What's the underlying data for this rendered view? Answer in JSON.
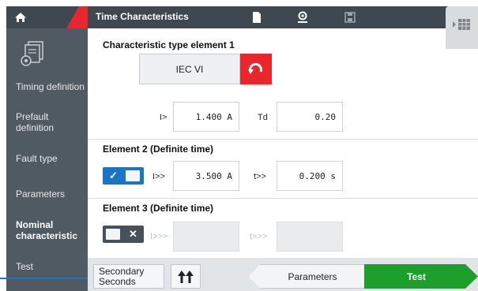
{
  "header": {
    "title": "Time Characteristics"
  },
  "sidebar": {
    "items": [
      {
        "label": "Timing definition",
        "active": false
      },
      {
        "label": "Prefault definition",
        "active": false
      },
      {
        "label": "Fault type",
        "active": false
      },
      {
        "label": "Parameters",
        "active": false
      },
      {
        "label": "Nominal characteristic",
        "active": true
      },
      {
        "label": "Test",
        "active": false
      }
    ]
  },
  "icons": {
    "home": "home-icon",
    "definition": "document-settings-icon",
    "header": [
      "document-icon",
      "person-location-icon",
      "save-icon"
    ],
    "panel": "grid-panel-icon",
    "reset": "undo-arrow-icon",
    "swap": "double-up-arrow-icon"
  },
  "main": {
    "element1": {
      "title": "Characteristic type element 1",
      "characteristic_value": "IEC VI",
      "i_label": "I>",
      "i_value": "1.400 A",
      "td_label": "Td",
      "td_value": "0.20"
    },
    "element2": {
      "title": "Element 2 (Definite time)",
      "enabled": true,
      "i_label": "I>>",
      "i_value": "3.500 A",
      "t_label": "t>>",
      "t_value": "0.200 s"
    },
    "element3": {
      "title": "Element 3 (Definite time)",
      "enabled": false,
      "i_label": "I>>>",
      "i_value": "",
      "t_label": "t>>>",
      "t_value": ""
    }
  },
  "bottombar": {
    "secondary_label": "Secondary Seconds",
    "prev_label": "Parameters",
    "next_label": "Test"
  },
  "colors": {
    "accent_red": "#e8262b",
    "header_dark": "#3f4850",
    "sidebar": "#505a62",
    "toggle_blue": "#1a76c4",
    "test_green": "#1da02b"
  }
}
